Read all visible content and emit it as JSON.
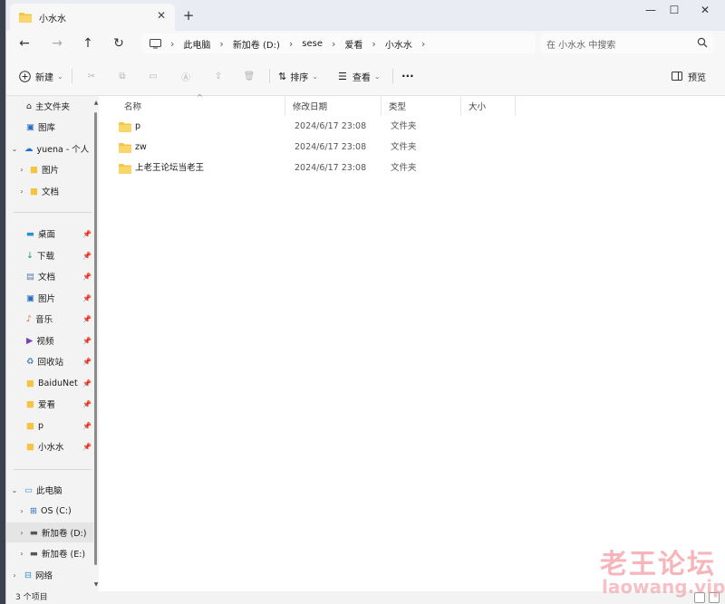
{
  "window": {
    "tab_title": "小水水",
    "new_tab": "+",
    "controls": {
      "minimize": "—",
      "maximize": "☐",
      "close": "✕"
    }
  },
  "address": {
    "back": "←",
    "forward": "→",
    "up": "↑",
    "refresh": "↻",
    "breadcrumb": [
      "此电脑",
      "新加卷 (D:)",
      "sese",
      "爱看",
      "小水水"
    ],
    "search_placeholder": "在 小水水 中搜索"
  },
  "toolbar": {
    "new_label": "新建",
    "sort_label": "排序",
    "view_label": "查看",
    "more_label": "···",
    "preview_label": "预览"
  },
  "sidebar": {
    "home": "主文件夹",
    "gallery": "图库",
    "onedrive": "yuena - 个人",
    "od_pictures": "图片",
    "od_documents": "文档",
    "desktop": "桌面",
    "downloads": "下载",
    "documents": "文档",
    "pictures": "图片",
    "music": "音乐",
    "videos": "视频",
    "recycle": "回收站",
    "baidu": "BaiduNet",
    "aikan": "爱看",
    "p": "p",
    "xiaoshui": "小水水",
    "thispc": "此电脑",
    "drive_c": "OS (C:)",
    "drive_d": "新加卷 (D:)",
    "drive_e": "新加卷 (E:)",
    "network": "网络"
  },
  "columns": {
    "name": "名称",
    "date": "修改日期",
    "type": "类型",
    "size": "大小"
  },
  "files": [
    {
      "name": "p",
      "date": "2024/6/17 23:08",
      "type": "文件夹"
    },
    {
      "name": "zw",
      "date": "2024/6/17 23:08",
      "type": "文件夹"
    },
    {
      "name": "上老王论坛当老王",
      "date": "2024/6/17 23:08",
      "type": "文件夹"
    }
  ],
  "status": {
    "count": "3 个项目"
  },
  "watermark": {
    "cn": "老王论坛",
    "en": "laowang.vip"
  },
  "colors": {
    "folder": "#f6c342",
    "accent": "#0067c0"
  }
}
